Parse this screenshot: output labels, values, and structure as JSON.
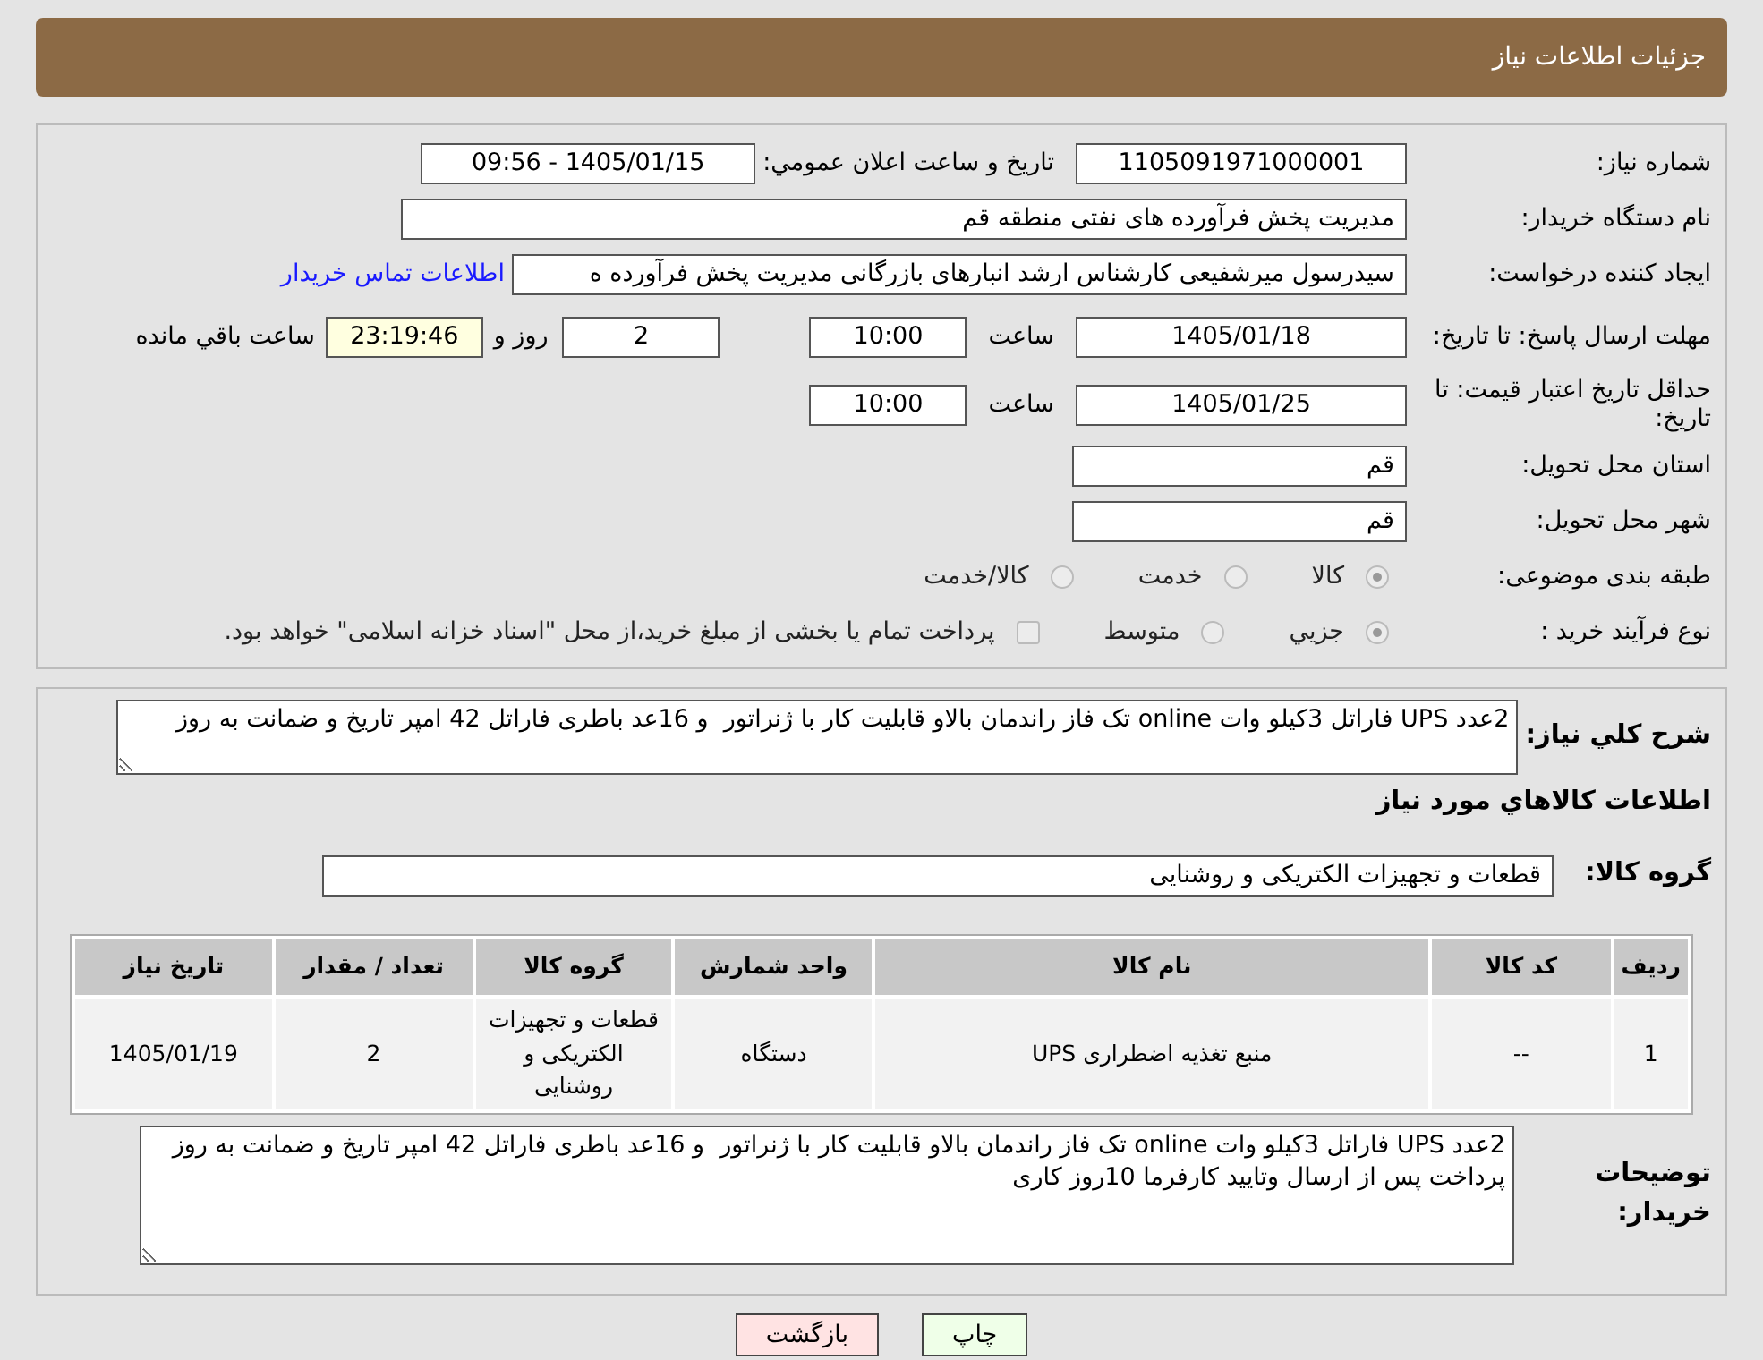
{
  "header": {
    "title": "جزئیات اطلاعات نیاز"
  },
  "need_number": {
    "label": "شماره نیاز:",
    "value": "1105091971000001"
  },
  "announce": {
    "label": "تاریخ و ساعت اعلان عمومي:",
    "value": "1405/01/15 - 09:56"
  },
  "buyer": {
    "label": "نام دستگاه خریدار:",
    "value": "مدیریت پخش فرآورده های نفتی منطقه قم"
  },
  "requester": {
    "label": "ایجاد کننده درخواست:",
    "value": "سیدرسول میرشفیعی کارشناس ارشد انبارهای بازرگانی مدیریت پخش فرآورده ه",
    "link": "اطلاعات تماس خریدار"
  },
  "reply_deadline": {
    "label": "مهلت ارسال پاسخ: تا تاریخ:",
    "date": "1405/01/18",
    "time_label": "ساعت",
    "time": "10:00",
    "days": "2",
    "days_label": "روز و",
    "remaining": "23:19:46",
    "remaining_label": "ساعت باقي مانده"
  },
  "price_validity": {
    "label": "حداقل تاریخ اعتبار قیمت: تا تاریخ:",
    "date": "1405/01/25",
    "time_label": "ساعت",
    "time": "10:00"
  },
  "province": {
    "label": "استان محل تحویل:",
    "value": "قم"
  },
  "city": {
    "label": "شهر محل تحویل:",
    "value": "قم"
  },
  "category": {
    "label": "طبقه بندی موضوعی:",
    "options": [
      {
        "label": "کالا",
        "selected": true
      },
      {
        "label": "خدمت",
        "selected": false
      },
      {
        "label": "کالا/خدمت",
        "selected": false
      }
    ]
  },
  "process": {
    "label": "نوع فرآیند خرید :",
    "options": [
      {
        "label": "جزیي",
        "selected": true
      },
      {
        "label": "متوسط",
        "selected": false
      }
    ],
    "payment": {
      "label": "پرداخت تمام یا بخشی از مبلغ خرید،از محل \"اسناد خزانه اسلامی\" خواهد بود.",
      "checked": false
    }
  },
  "description": {
    "label": "شرح کلي نیاز:",
    "value": "2عدد UPS فاراتل 3کیلو وات online تک فاز راندمان بالاو قابلیت کار با ژنراتور  و 16عد باطری فاراتل 42 امپر تاریخ و ضمانت به روز"
  },
  "goods_title": "اطلاعات کالاهاي مورد نیاز",
  "group": {
    "label": "گروه کالا:",
    "value": "قطعات و تجهیزات الکتریکی و روشنایی"
  },
  "table": {
    "columns": [
      "ردیف",
      "کد کالا",
      "نام کالا",
      "واحد شمارش",
      "گروه کالا",
      "تعداد / مقدار",
      "تاریخ نیاز"
    ],
    "rows": [
      [
        "1",
        "--",
        "منبع تغذیه اضطراری UPS",
        "دستگاه",
        "قطعات و تجهیزات الکتریکی و روشنایی",
        "2",
        "1405/01/19"
      ]
    ]
  },
  "buyer_notes": {
    "label": "توضیحات خریدار:",
    "value": "2عدد UPS فاراتل 3کیلو وات online تک فاز راندمان بالاو قابلیت کار با ژنراتور  و 16عد باطری فاراتل 42 امپر تاریخ و ضمانت به روز پرداخت پس از ارسال وتایید کارفرما 10روز کاری"
  },
  "buttons": [
    {
      "label": "چاپ",
      "kind": "print"
    },
    {
      "label": "بازگشت",
      "kind": "back"
    }
  ]
}
